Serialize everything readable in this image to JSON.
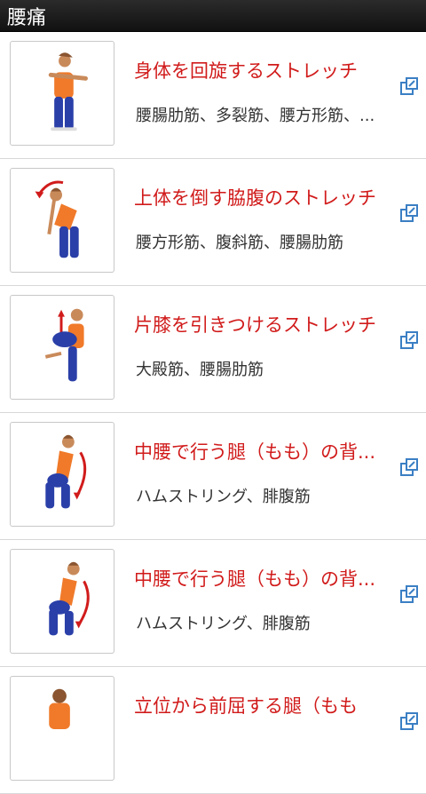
{
  "app": {
    "title": "腰痛"
  },
  "colors": {
    "title_red": "#d11b1b",
    "icon_blue": "#3b7fc4",
    "shirt": "#f07a2a",
    "pants": "#2a3fa8"
  },
  "items": [
    {
      "title": "身体を回旋するストレッチ",
      "muscles": "腰腸肋筋、多裂筋、腰方形筋、...",
      "icon": "external-link-icon"
    },
    {
      "title": "上体を倒す脇腹のストレッチ",
      "muscles": "腰方形筋、腹斜筋、腰腸肋筋",
      "icon": "external-link-icon"
    },
    {
      "title": "片膝を引きつけるストレッチ",
      "muscles": "大殿筋、腰腸肋筋",
      "icon": "external-link-icon"
    },
    {
      "title": "中腰で行う腿（もも）の背...",
      "muscles": "ハムストリング、腓腹筋",
      "icon": "external-link-icon"
    },
    {
      "title": "中腰で行う腿（もも）の背...",
      "muscles": "ハムストリング、腓腹筋",
      "icon": "external-link-icon"
    },
    {
      "title": "立位から前屈する腿（もも",
      "muscles": "",
      "icon": "external-link-icon"
    }
  ]
}
